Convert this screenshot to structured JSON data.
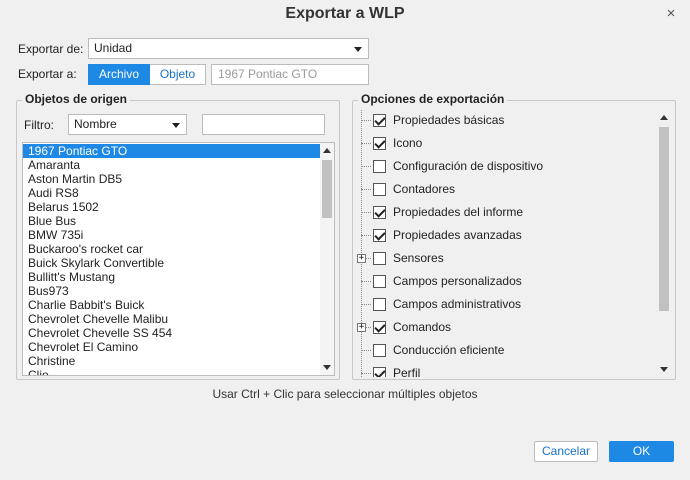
{
  "window": {
    "title": "Exportar a WLP",
    "close_glyph": "×"
  },
  "export_from": {
    "label": "Exportar de:",
    "value": "Unidad"
  },
  "export_to": {
    "label": "Exportar a:",
    "tabs": [
      "Archivo",
      "Objeto"
    ],
    "active_tab": "Archivo",
    "object_field_value": "1967 Pontiac GTO"
  },
  "source_objects": {
    "title": "Objetos de origen",
    "filter_label": "Filtro:",
    "filter_value": "Nombre",
    "filter_text": "",
    "items": [
      "1967 Pontiac GTO",
      "Amaranta",
      "Aston Martin DB5",
      "Audi RS8",
      "Belarus 1502",
      "Blue Bus",
      "BMW 735i",
      "Buckaroo's rocket car",
      "Buick Skylark Convertible",
      "Bullitt's Mustang",
      "Bus973",
      "Charlie Babbit's Buick",
      "Chevrolet Chevelle Malibu",
      "Chevrolet Chevelle SS 454",
      "Chevrolet El Camino",
      "Christine",
      "Clio"
    ],
    "selected_index": 0
  },
  "export_options": {
    "title": "Opciones de exportación",
    "items": [
      {
        "label": "Propiedades básicas",
        "checked": true,
        "expandable": false
      },
      {
        "label": "Icono",
        "checked": true,
        "expandable": false
      },
      {
        "label": "Configuración de dispositivo",
        "checked": false,
        "expandable": false
      },
      {
        "label": "Contadores",
        "checked": false,
        "expandable": false
      },
      {
        "label": "Propiedades del informe",
        "checked": true,
        "expandable": false
      },
      {
        "label": "Propiedades avanzadas",
        "checked": true,
        "expandable": false
      },
      {
        "label": "Sensores",
        "checked": false,
        "expandable": true
      },
      {
        "label": "Campos personalizados",
        "checked": false,
        "expandable": false
      },
      {
        "label": "Campos administrativos",
        "checked": false,
        "expandable": false
      },
      {
        "label": "Comandos",
        "checked": true,
        "expandable": true
      },
      {
        "label": "Conducción eficiente",
        "checked": false,
        "expandable": false
      },
      {
        "label": "Perfil",
        "checked": true,
        "expandable": false
      }
    ]
  },
  "hint": "Usar Ctrl + Clic para seleccionar múltiples objetos",
  "buttons": {
    "cancel": "Cancelar",
    "ok": "OK"
  },
  "colors": {
    "accent": "#1e88e5",
    "link": "#1a73c8",
    "background": "#f0f0f0"
  }
}
